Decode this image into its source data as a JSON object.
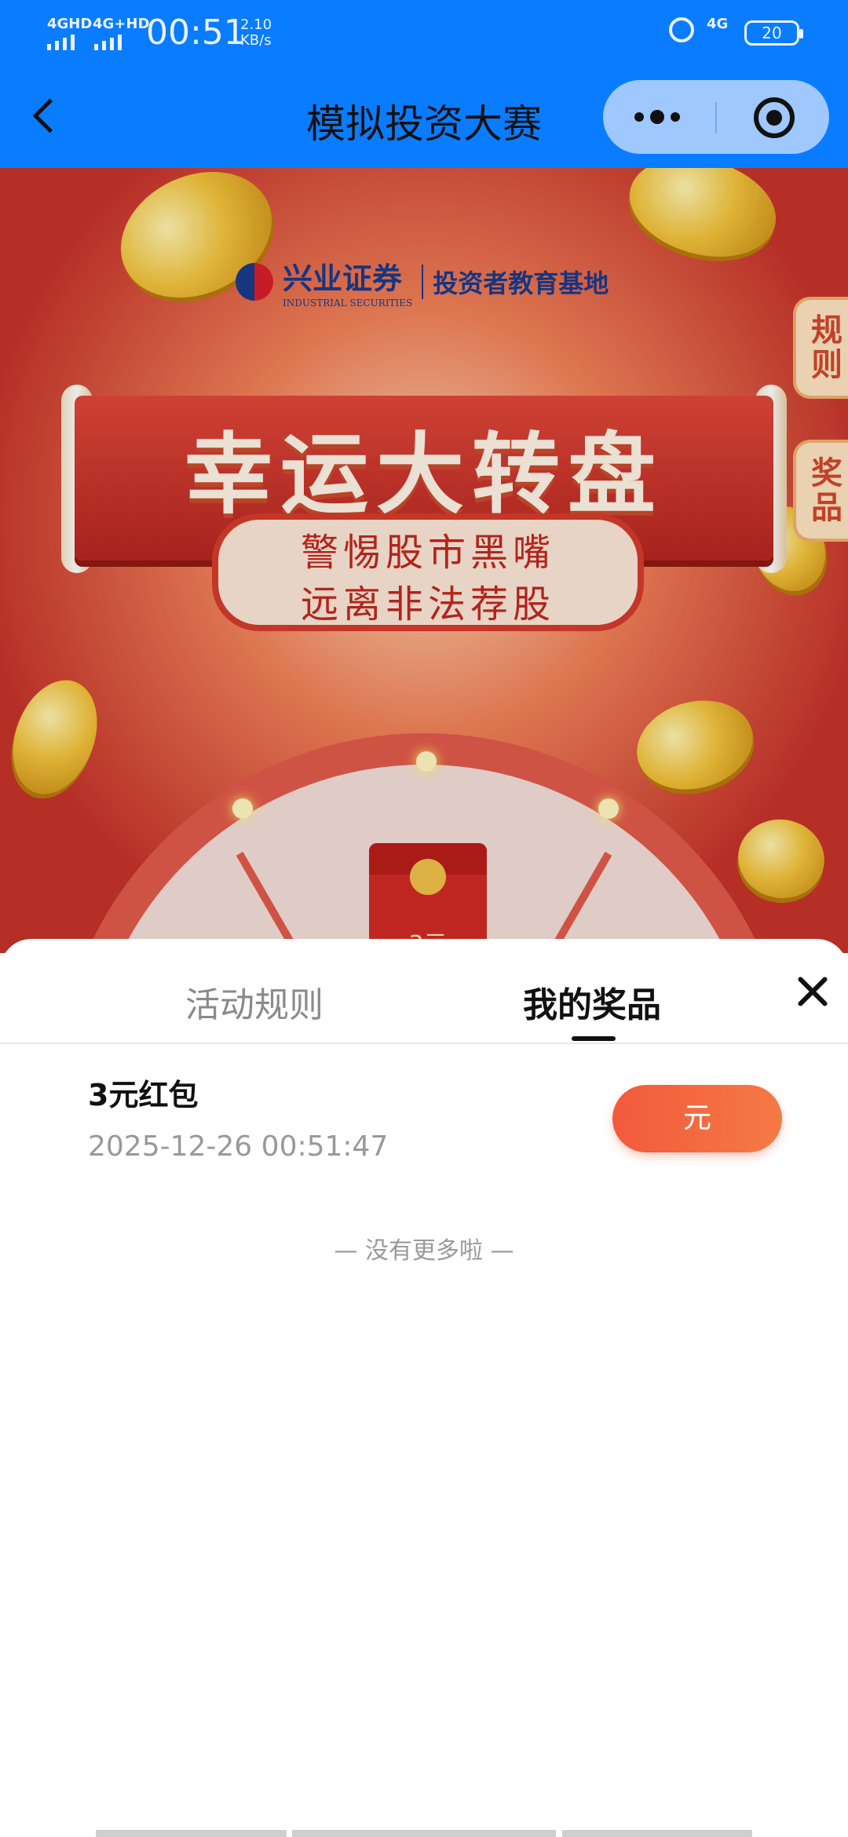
{
  "status_bar": {
    "signal_1": "4GHD",
    "signal_2": "4G+HD",
    "time": "00:51",
    "speed_value": "2.10",
    "speed_unit": "KB/s",
    "network": "4G",
    "battery": "20"
  },
  "title_bar": {
    "title": "模拟投资大赛",
    "more_icon": "more-dots-icon",
    "close_icon": "target-icon"
  },
  "banner": {
    "brand": "兴业证券",
    "brand_en": "INDUSTRIAL SECURITIES",
    "edu": "投资者教育基地",
    "headline": "幸运大转盘",
    "slogan_line1": "警惕股市黑嘴",
    "slogan_line2": "远离非法荐股",
    "side_tab_rules": "规则",
    "side_tab_prizes": "奖品",
    "wheel_prize": "3元"
  },
  "sheet": {
    "tabs": [
      {
        "label": "活动规则",
        "active": false
      },
      {
        "label": "我的奖品",
        "active": true
      }
    ],
    "prizes": [
      {
        "name": "3元红包",
        "time": "2025-12-26 00:51:47",
        "action": "元"
      }
    ],
    "no_more": "— 没有更多啦 —"
  },
  "colors": {
    "accent_blue": "#0a7cff",
    "button_orange": "#f25a3c",
    "banner_red": "#c5332a"
  }
}
